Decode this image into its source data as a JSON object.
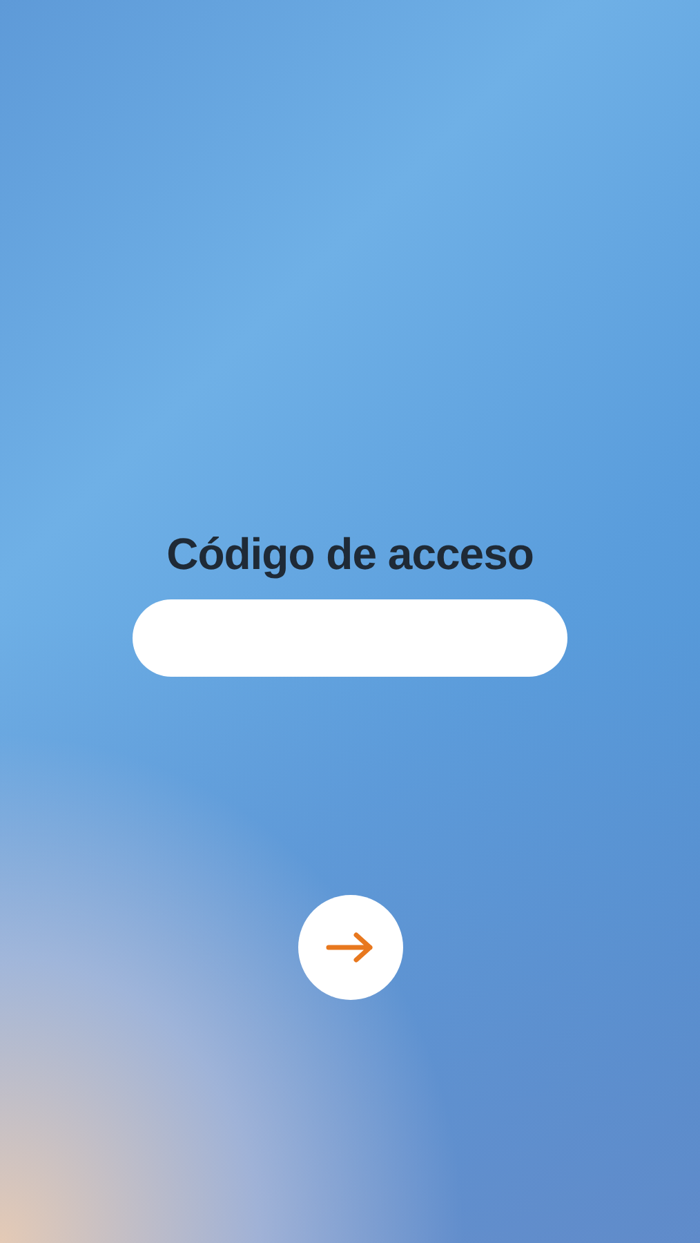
{
  "title": "Código de acceso"
}
